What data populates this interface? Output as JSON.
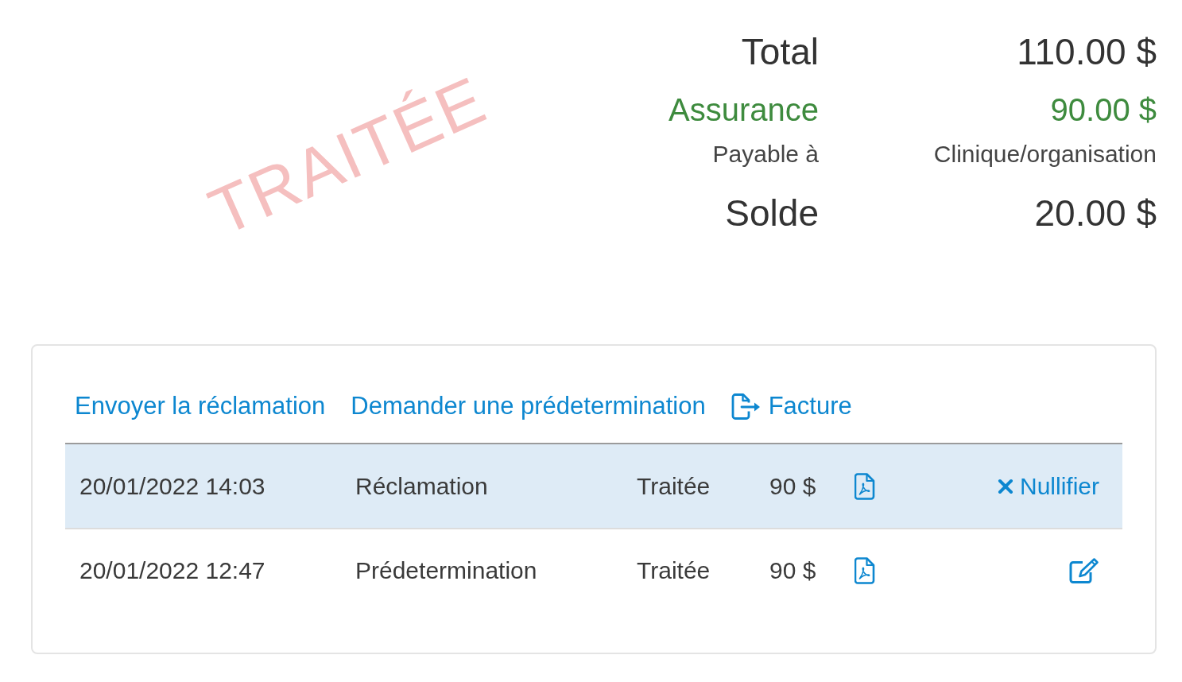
{
  "stamp": {
    "text": "TRAITÉE"
  },
  "summary": [
    {
      "kind": "total",
      "label": "Total",
      "value": "110.00 $"
    },
    {
      "kind": "insurance",
      "label": "Assurance",
      "value": "90.00 $"
    },
    {
      "kind": "payable",
      "label": "Payable à",
      "value": "Clinique/organisation"
    },
    {
      "kind": "balance",
      "label": "Solde",
      "value": "20.00 $"
    }
  ],
  "actions": [
    {
      "kind": "link",
      "label": "Envoyer la réclamation"
    },
    {
      "kind": "link",
      "label": "Demander une prédetermination"
    },
    {
      "kind": "export",
      "label": "Facture"
    }
  ],
  "table": {
    "rows": [
      {
        "cells": [
          "20/01/2022 14:03",
          "Réclamation",
          "Traitée",
          "90 $"
        ],
        "selected": true,
        "action": {
          "kind": "nullify",
          "label": "Nullifier"
        }
      },
      {
        "cells": [
          "20/01/2022 12:47",
          "Prédetermination",
          "Traitée",
          "90 $"
        ],
        "selected": false,
        "action": {
          "kind": "edit"
        }
      }
    ]
  }
}
